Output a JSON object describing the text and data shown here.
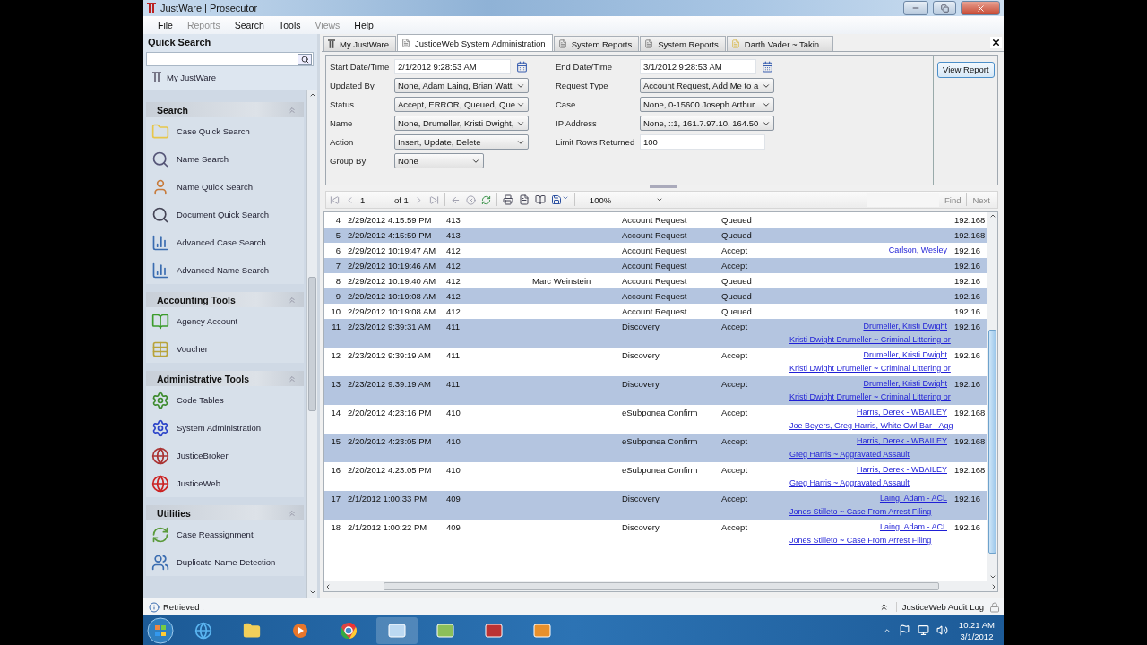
{
  "window": {
    "title": "JustWare | Prosecutor"
  },
  "menu": [
    {
      "label": "File",
      "disabled": false
    },
    {
      "label": "Reports",
      "disabled": true
    },
    {
      "label": "Search",
      "disabled": false
    },
    {
      "label": "Tools",
      "disabled": false
    },
    {
      "label": "Views",
      "disabled": true
    },
    {
      "label": "Help",
      "disabled": false
    }
  ],
  "sidebar": {
    "title": "Quick Search",
    "home": "My JustWare",
    "groups": [
      {
        "title": "Search",
        "expanded": true,
        "items": [
          "Case Quick Search",
          "Name Search",
          "Name Quick Search",
          "Document Quick Search",
          "Advanced Case Search",
          "Advanced Name Search"
        ]
      },
      {
        "title": "Accounting Tools",
        "expanded": true,
        "items": [
          "Agency Account",
          "Voucher"
        ]
      },
      {
        "title": "Administrative Tools",
        "expanded": true,
        "items": [
          "Code Tables",
          "System Administration",
          "JusticeBroker",
          "JusticeWeb"
        ]
      },
      {
        "title": "Utilities",
        "expanded": true,
        "items": [
          "Case Reassignment",
          "Duplicate Name Detection"
        ]
      }
    ]
  },
  "tabs": [
    {
      "label": "My JustWare",
      "selected": false
    },
    {
      "label": "JusticeWeb System Administration",
      "selected": true
    },
    {
      "label": "System Reports",
      "selected": false
    },
    {
      "label": "System Reports",
      "selected": false
    },
    {
      "label": "Darth Vader ~ Takin...",
      "selected": false
    }
  ],
  "filters": {
    "left": [
      {
        "label": "Start Date/Time",
        "kind": "date",
        "value": "2/1/2012 9:28:53 AM"
      },
      {
        "label": "Updated By",
        "kind": "dropdown",
        "value": "None, Adam Laing, Brian Watt"
      },
      {
        "label": "Status",
        "kind": "dropdown",
        "value": "Accept, ERROR, Queued, Que"
      },
      {
        "label": "Name",
        "kind": "dropdown",
        "value": "None, Drumeller, Kristi Dwight,"
      },
      {
        "label": "Action",
        "kind": "dropdown",
        "value": "Insert, Update, Delete"
      },
      {
        "label": "Group By",
        "kind": "dropdown",
        "value": "None"
      }
    ],
    "right": [
      {
        "label": "End Date/Time",
        "kind": "date",
        "value": "3/1/2012 9:28:53 AM"
      },
      {
        "label": "Request Type",
        "kind": "dropdown",
        "value": "Account Request, Add Me to a"
      },
      {
        "label": "Case",
        "kind": "dropdown",
        "value": "None, 0-15600 Joseph Arthur"
      },
      {
        "label": "IP Address",
        "kind": "dropdown",
        "value": "None, ::1, 161.7.97.10, 164.50"
      },
      {
        "label": "Limit Rows Returned",
        "kind": "text",
        "value": "100"
      }
    ],
    "button": "View Report"
  },
  "report_toolbar": {
    "page": "1",
    "page_count": "of 1",
    "zoom": "100%",
    "find": "Find",
    "next": "Next"
  },
  "rows": [
    {
      "number": "4",
      "date": "2/29/2012 4:15:59 PM",
      "id": "413",
      "type": "Account Request",
      "status": "Queued",
      "ip": "192.168"
    },
    {
      "number": "5",
      "date": "2/29/2012 4:15:59 PM",
      "id": "413",
      "type": "Account Request",
      "status": "Queued",
      "ip": "192.168"
    },
    {
      "number": "6",
      "date": "2/29/2012 10:19:47 AM",
      "id": "412",
      "type": "Account Request",
      "status": "Accept",
      "person_link": "Carlson, Wesley",
      "ip": "192.16"
    },
    {
      "number": "7",
      "date": "2/29/2012 10:19:46 AM",
      "id": "412",
      "type": "Account Request",
      "status": "Accept",
      "ip": "192.16"
    },
    {
      "number": "8",
      "date": "2/29/2012 10:19:40 AM",
      "id": "412",
      "name": "Marc Weinstein",
      "type": "Account Request",
      "status": "Queued",
      "ip": "192.16"
    },
    {
      "number": "9",
      "date": "2/29/2012 10:19:08 AM",
      "id": "412",
      "type": "Account Request",
      "status": "Queued",
      "ip": "192.16"
    },
    {
      "number": "10",
      "date": "2/29/2012 10:19:08 AM",
      "id": "412",
      "type": "Account Request",
      "status": "Queued",
      "ip": "192.16"
    },
    {
      "number": "11",
      "date": "2/23/2012 9:39:31 AM",
      "id": "411",
      "type": "Discovery",
      "status": "Accept",
      "person_link": "Drumeller, Kristi Dwight",
      "ip": "192.16",
      "case_link": "Kristi Dwight Drumeller ~ Criminal Littering or"
    },
    {
      "number": "12",
      "date": "2/23/2012 9:39:19 AM",
      "id": "411",
      "type": "Discovery",
      "status": "Accept",
      "person_link": "Drumeller, Kristi Dwight",
      "ip": "192.16",
      "case_link": "Kristi Dwight Drumeller ~ Criminal Littering or"
    },
    {
      "number": "13",
      "date": "2/23/2012 9:39:19 AM",
      "id": "411",
      "type": "Discovery",
      "status": "Accept",
      "person_link": "Drumeller, Kristi Dwight",
      "ip": "192.16",
      "case_link": "Kristi Dwight Drumeller ~ Criminal Littering or"
    },
    {
      "number": "14",
      "date": "2/20/2012 4:23:16 PM",
      "id": "410",
      "type": "eSubponea Confirm",
      "status": "Accept",
      "person_link": "Harris, Derek - WBAILEY",
      "ip": "192.168",
      "case_link": "Joe Beyers, Greg Harris, White Owl Bar - Agg"
    },
    {
      "number": "15",
      "date": "2/20/2012 4:23:05 PM",
      "id": "410",
      "type": "eSubponea Confirm",
      "status": "Accept",
      "person_link": "Harris, Derek - WBAILEY",
      "ip": "192.168",
      "case_link": "Greg Harris ~ Aggravated Assault"
    },
    {
      "number": "16",
      "date": "2/20/2012 4:23:05 PM",
      "id": "410",
      "type": "eSubponea Confirm",
      "status": "Accept",
      "person_link": "Harris, Derek - WBAILEY",
      "ip": "192.168",
      "case_link": "Greg Harris ~ Aggravated Assault"
    },
    {
      "number": "17",
      "date": "2/1/2012 1:00:33 PM",
      "id": "409",
      "type": "Discovery",
      "status": "Accept",
      "person_link": "Laing, Adam - ACL",
      "ip": "192.16",
      "case_link": "Jones Stilleto ~ Case From Arrest Filing"
    },
    {
      "number": "18",
      "date": "2/1/2012 1:00:22 PM",
      "id": "409",
      "type": "Discovery",
      "status": "Accept",
      "person_link": "Laing, Adam - ACL",
      "ip": "192.16",
      "case_link": "Jones Stilleto ~ Case From Arrest Filing"
    }
  ],
  "status_bar": {
    "text": "Retrieved .",
    "panel": "JusticeWeb Audit Log"
  },
  "taskbar": {
    "time": "10:21 AM",
    "date": "3/1/2012"
  }
}
